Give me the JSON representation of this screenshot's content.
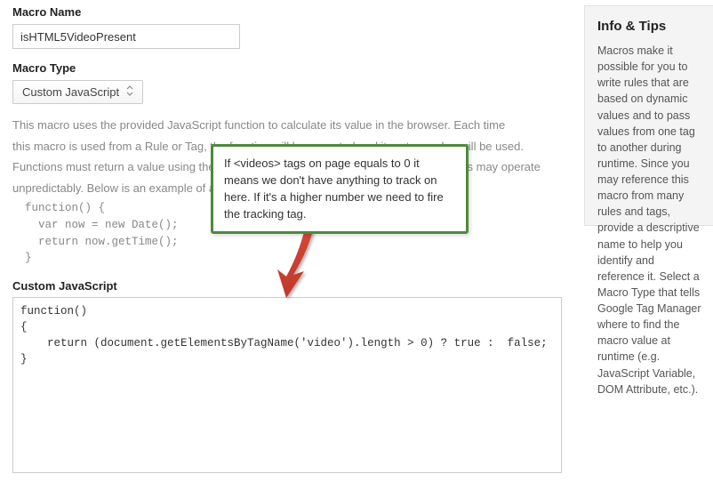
{
  "labels": {
    "macroName": "Macro Name",
    "macroType": "Macro Type",
    "customJs": "Custom JavaScript"
  },
  "fields": {
    "macroNameValue": "isHTML5VideoPresent",
    "macroTypeValue": "Custom JavaScript"
  },
  "description": {
    "line1": "This macro uses the provided JavaScript function to calculate its value in the browser. Each time",
    "line2": "this macro is used from a Rule or Tag, the function will be executed and its return value will be used.",
    "line3": "Functions must return a value using the 'return' statement. Functions without return values may operate",
    "line4": "unpredictably. Below is an example of a function that returns the time:"
  },
  "exampleCode": "function() {\n  var now = new Date();\n  return now.getTime();\n}",
  "customCode": "function()\n{\n    return (document.getElementsByTagName('video').length > 0) ? true :  false;\n}",
  "callout": "If <videos> tags on page equals to 0 it means we don't have anything to track on here. If it's a higher number we need to fire the tracking tag.",
  "sidebar": {
    "title": "Info & Tips",
    "body": "Macros make it possible for you to write rules that are based on dynamic values and to pass values from one tag to another during runtime. Since you may reference this macro from many rules and tags, provide a descriptive name to help you identify and reference it. Select a Macro Type that tells Google Tag Manager where to find the macro value at runtime (e.g. JavaScript Variable, DOM Attribute, etc.)."
  }
}
